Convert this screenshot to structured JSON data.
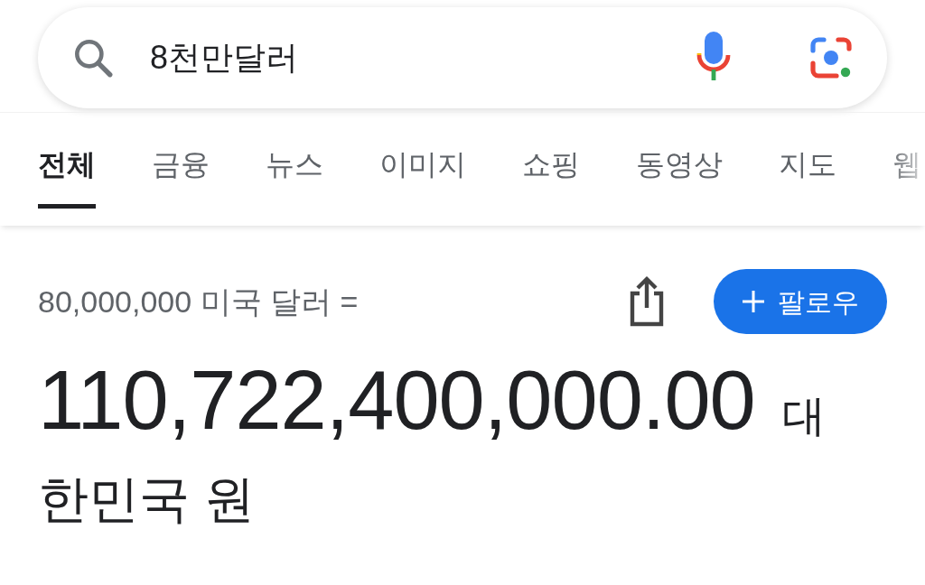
{
  "search": {
    "value": "8천만달러"
  },
  "tabs": [
    {
      "label": "전체",
      "selected": true
    },
    {
      "label": "금융",
      "selected": false
    },
    {
      "label": "뉴스",
      "selected": false
    },
    {
      "label": "이미지",
      "selected": false
    },
    {
      "label": "쇼핑",
      "selected": false
    },
    {
      "label": "동영상",
      "selected": false
    },
    {
      "label": "지도",
      "selected": false
    },
    {
      "label": "웹",
      "selected": false
    }
  ],
  "result": {
    "source": "80,000,000 미국 달러 =",
    "follow_button": "팔로우",
    "amount": "110,722,400,000.00",
    "currency_start": "대",
    "currency_rest": "한민국 원"
  }
}
